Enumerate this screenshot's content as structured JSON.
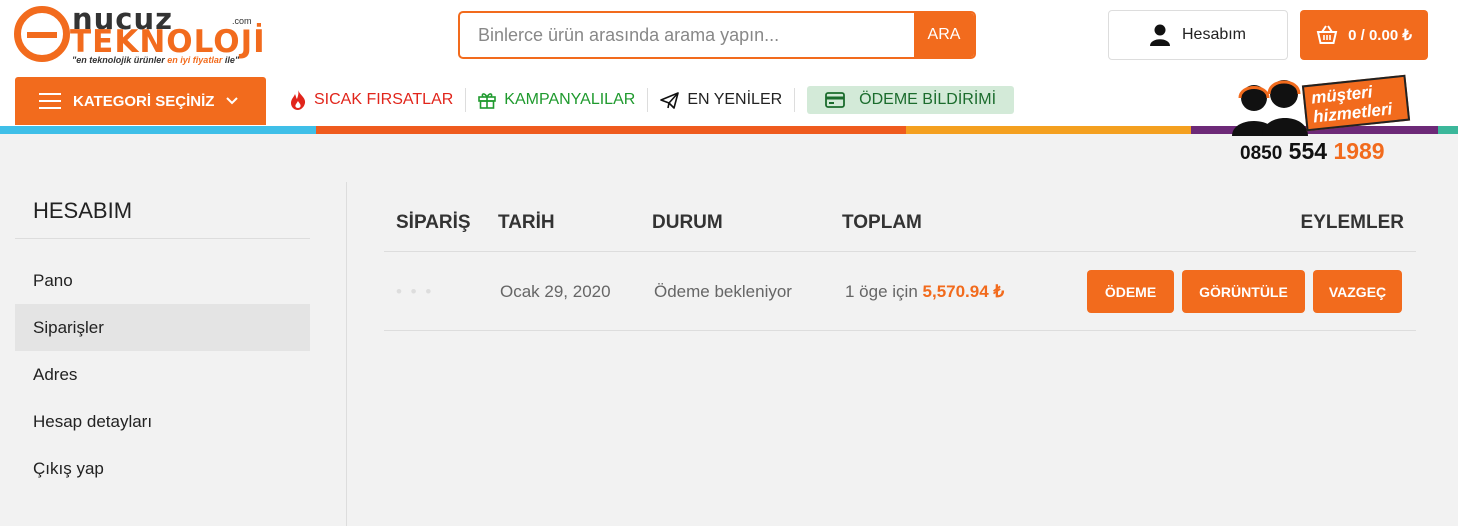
{
  "brand": {
    "name_top": "nucuz",
    "name_bottom": "TEKNOLOJİ",
    "tld": ".com",
    "slogan_pre": "\"en teknolojik ürünler ",
    "slogan_hl": "en iyi fiyatlar",
    "slogan_post": " ile\"",
    "accent": "#f26b1d"
  },
  "search": {
    "placeholder": "Binlerce ürün arasında arama yapın...",
    "button": "ARA"
  },
  "account": {
    "label": "Hesabım",
    "icon": "user-icon"
  },
  "cart": {
    "label": "0 / 0.00 ₺",
    "icon": "basket-icon"
  },
  "nav": {
    "category_button": "KATEGORİ SEÇİNİZ",
    "items": [
      {
        "label": "SICAK FIRSATLAR",
        "icon": "fire-icon",
        "color": "#e1251b"
      },
      {
        "label": "KAMPANYALILAR",
        "icon": "gift-icon",
        "color": "#1f9a2e"
      },
      {
        "label": "EN YENİLER",
        "icon": "paper-plane-icon",
        "color": "#222222"
      },
      {
        "label": "ÖDEME BİLDİRİMİ",
        "icon": "credit-card-icon",
        "color": "#1b6c2d"
      }
    ]
  },
  "support": {
    "badge_line1": "müşteri",
    "badge_line2": "hizmetleri",
    "phone_a": "0850",
    "phone_b": "554",
    "phone_c": "1989"
  },
  "sidebar": {
    "title": "HESABIM",
    "items": [
      {
        "label": "Pano"
      },
      {
        "label": "Siparişler",
        "active": true
      },
      {
        "label": "Adres"
      },
      {
        "label": "Hesap detayları"
      },
      {
        "label": "Çıkış yap"
      }
    ]
  },
  "orders": {
    "headers": {
      "order": "SİPARİŞ",
      "date": "TARİH",
      "status": "DURUM",
      "total": "TOPLAM",
      "actions": "EYLEMLER"
    },
    "rows": [
      {
        "number": "• • •",
        "date": "Ocak 29, 2020",
        "status": "Ödeme bekleniyor",
        "total_prefix": "1 öge için",
        "total_price": "5,570.94 ₺",
        "actions": [
          "ÖDEME",
          "GÖRÜNTÜLE",
          "VAZGEÇ"
        ]
      }
    ]
  }
}
